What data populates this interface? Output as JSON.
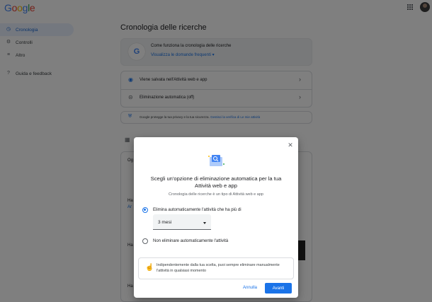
{
  "header": {
    "logo": "Google"
  },
  "sidebar": {
    "items": [
      {
        "label": "Cronologia",
        "icon": "clock-icon"
      },
      {
        "label": "Controlli",
        "icon": "settings-icon"
      },
      {
        "label": "Altro",
        "icon": "menu-icon"
      },
      {
        "label": "Guida e feedback",
        "icon": "help-icon"
      }
    ]
  },
  "main": {
    "title": "Cronologia delle ricerche",
    "howto": {
      "title": "Come funziona la cronologia delle ricerche",
      "link": "Visualizza le domande frequenti"
    },
    "rows": [
      {
        "label": "Viene salvata nell'Attività web e app"
      },
      {
        "label": "Eliminazione automatica (off)"
      }
    ],
    "privacy": {
      "text": "Google protegge la tua privacy e la tua sicurezza.",
      "link": "Gestisci la verifica di Le mie attività"
    },
    "bg_fragments": [
      "Og",
      "Ha",
      "Ar",
      "Ha",
      "Ha"
    ]
  },
  "dialog": {
    "title": "Scegli un'opzione di eliminazione automatica per la tua Attività web e app",
    "subtitle": "Cronologia delle ricerche è un tipo di Attività web e app",
    "option_1": "Elimina automaticamente l'attività che ha più di",
    "select_value": "3 mesi",
    "option_2": "Non eliminare automaticamente l'attività",
    "info": "Indipendentemente dalla tua scelta, puoi sempre eliminare manualmente l'attività in qualsiasi momento",
    "cancel": "Annulla",
    "next": "Avanti"
  },
  "colors": {
    "accent": "#1a73e8",
    "overlay": "rgba(0,0,0,0.5)"
  }
}
